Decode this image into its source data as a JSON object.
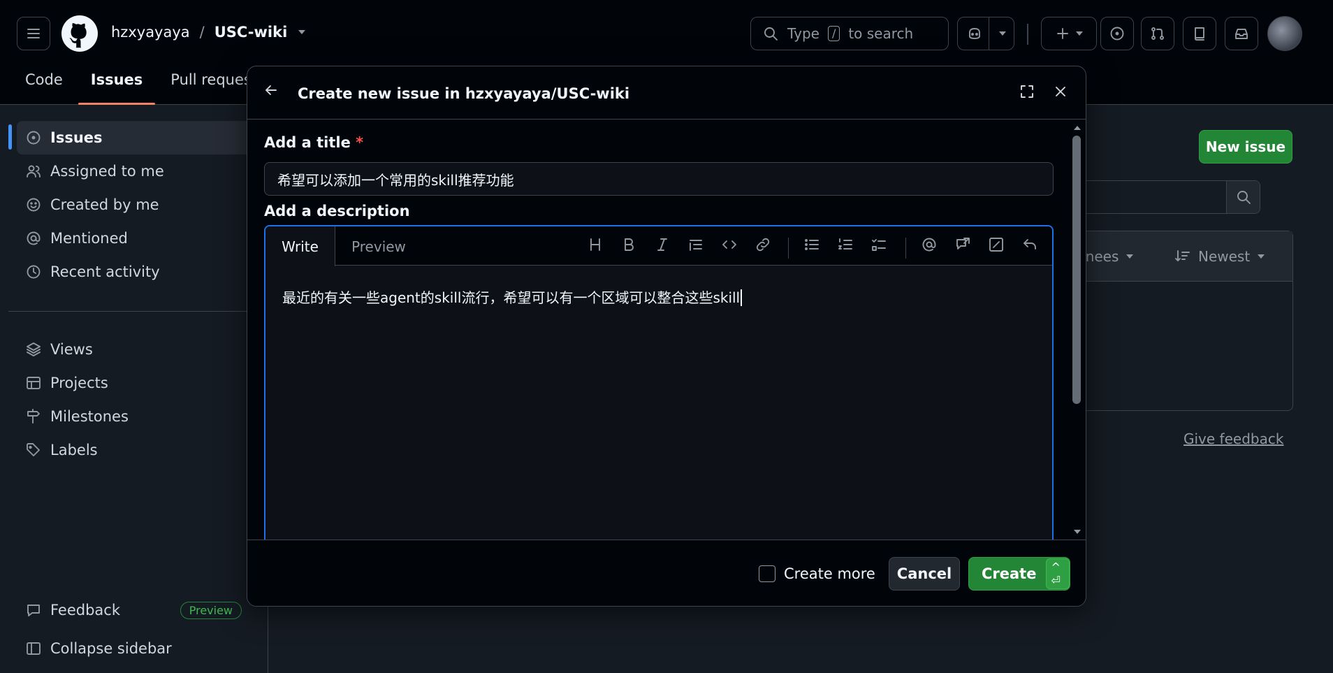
{
  "header": {
    "owner": "hzxyayaya",
    "separator": "/",
    "repo": "USC-wiki",
    "search": {
      "prefix": "Type",
      "key": "/",
      "suffix": "to search"
    }
  },
  "repo_tabs": [
    "Code",
    "Issues",
    "Pull requests"
  ],
  "sidebar": {
    "items": [
      "Issues",
      "Assigned to me",
      "Created by me",
      "Mentioned",
      "Recent activity"
    ],
    "items2": [
      "Views",
      "Projects",
      "Milestones",
      "Labels"
    ],
    "feedback": "Feedback",
    "preview_badge": "Preview",
    "collapse": "Collapse sidebar"
  },
  "background": {
    "new_issue": "New issue",
    "assignees_partial": "gnees",
    "sort": "Newest",
    "give_feedback": "Give feedback"
  },
  "modal": {
    "title": "Create new issue in hzxyayaya/USC-wiki",
    "title_label": "Add a title",
    "required_mark": "*",
    "title_value": "希望可以添加一个常用的skill推荐功能",
    "description_label": "Add a description",
    "tab_write": "Write",
    "tab_preview": "Preview",
    "description_value": "最近的有关一些agent的skill流行，希望可以有一个区域可以整合这些skill",
    "create_more": "Create more",
    "cancel": "Cancel",
    "create": "Create",
    "create_shortcut": "^ ⏎"
  },
  "colors": {
    "accent_blue": "#1f6feb",
    "success_green": "#238636",
    "tab_underline": "#f78166",
    "danger": "#f85149"
  }
}
